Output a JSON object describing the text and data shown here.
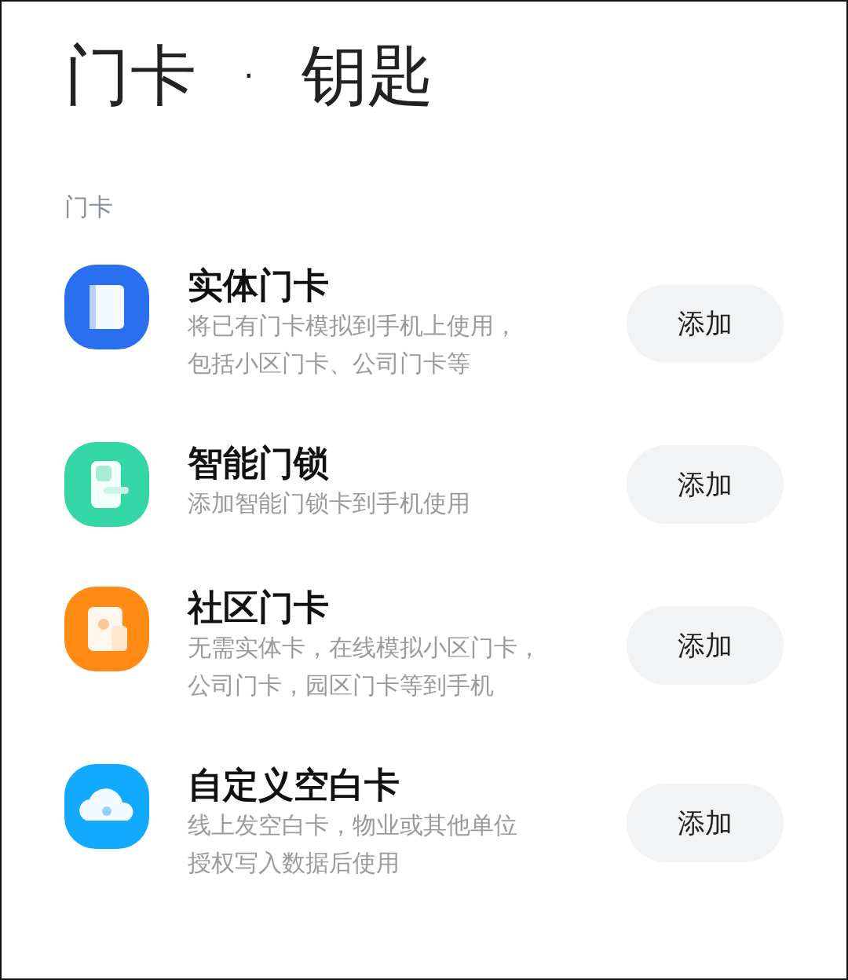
{
  "title": "门卡  ·  钥匙",
  "section_label": "门卡",
  "items": [
    {
      "kind": "card",
      "color": "#2a6ff0",
      "title": "实体门卡",
      "description_lines": [
        "将已有门卡模拟到手机上使用，",
        "包括小区门卡、公司门卡等"
      ],
      "button": "添加"
    },
    {
      "kind": "lock",
      "color": "#35d6a6",
      "title": "智能门锁",
      "description_lines": [
        "添加智能门锁卡到手机使用"
      ],
      "button": "添加"
    },
    {
      "kind": "community",
      "color": "#ff8a14",
      "title": "社区门卡",
      "description_lines": [
        "无需实体卡，在线模拟小区门卡，",
        "公司门卡，园区门卡等到手机"
      ],
      "button": "添加"
    },
    {
      "kind": "cloud",
      "color": "#12aaff",
      "title": "自定义空白卡",
      "description_lines": [
        "线上发空白卡，物业或其他单位",
        "授权写入数据后使用"
      ],
      "button": "添加"
    }
  ]
}
